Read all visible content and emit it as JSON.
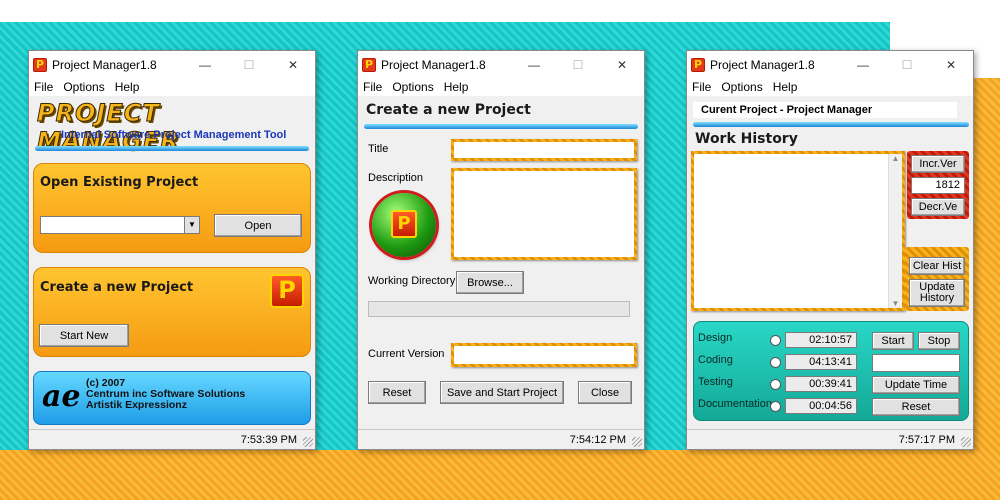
{
  "app": {
    "title": "Project Manager1.8",
    "menu": [
      "File",
      "Options",
      "Help"
    ],
    "icon_letter": "P",
    "controls": {
      "minimize": "—",
      "maximize": "☐",
      "close": "✕"
    }
  },
  "start_window": {
    "logo": "PROJECT MANAGER",
    "subtitle": "Internal Software Project Management Tool",
    "open_panel_title": "Open Existing Project",
    "project_select_value": "",
    "open_button": "Open",
    "new_panel_title": "Create a new Project",
    "start_new_button": "Start New",
    "credit_logo": "ae",
    "credits_line1": "(c) 2007",
    "credits_line2": "Centrum inc Software Solutions",
    "credits_line3": "Artistik Expressionz",
    "status_time": "7:53:39 PM"
  },
  "create_window": {
    "heading": "Create a new Project",
    "title_label": "Title",
    "title_value": "",
    "description_label": "Description",
    "description_value": "",
    "working_dir_label": "Working Directory",
    "browse_button": "Browse...",
    "current_version_label": "Current Version",
    "current_version_value": "",
    "reset_button": "Reset",
    "save_button": "Save and Start Project",
    "close_button": "Close",
    "status_time": "7:54:12 PM"
  },
  "history_window": {
    "current_project": "Curent Project - Project Manager",
    "heading": "Work History",
    "history_text": "",
    "incr_button": "Incr.Ver",
    "version_value": "1812",
    "decr_button": "Decr.Ve",
    "clear_button": "Clear Hist",
    "update_history_button": "Update History",
    "tasks": [
      {
        "name": "Design",
        "time": "02:10:57"
      },
      {
        "name": "Coding",
        "time": "04:13:41"
      },
      {
        "name": "Testing",
        "time": "00:39:41"
      },
      {
        "name": "Documentation",
        "time": "00:04:56"
      }
    ],
    "start_button": "Start",
    "stop_button": "Stop",
    "timer_value": "",
    "update_time_button": "Update Time",
    "reset_button": "Reset",
    "status_time": "7:57:17 PM"
  },
  "colors": {
    "teal_bg": "#16c6c6",
    "orange_bg": "#f5a21c",
    "accent_blue": "#1f86d9",
    "panel_orange": "#f59b12"
  }
}
